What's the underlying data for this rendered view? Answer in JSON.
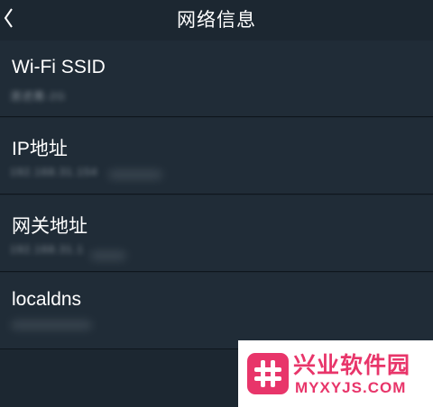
{
  "header": {
    "title": "网络信息",
    "back_icon": "chevron-left-icon"
  },
  "rows": [
    {
      "label": "Wi-Fi SSID",
      "value": "清述鹰-2G"
    },
    {
      "label": "IP地址",
      "value": "192.168.31.154"
    },
    {
      "label": "网关地址",
      "value": "192.168.31.1"
    },
    {
      "label": "localdns",
      "value": ""
    }
  ],
  "watermark": {
    "title": "兴业软件园",
    "url": "MYXYJS.COM",
    "icon": "hash-icon",
    "color": "#e8356a"
  },
  "colors": {
    "background": "#1c2731",
    "row_background": "#202c37",
    "text": "#ffffff"
  }
}
